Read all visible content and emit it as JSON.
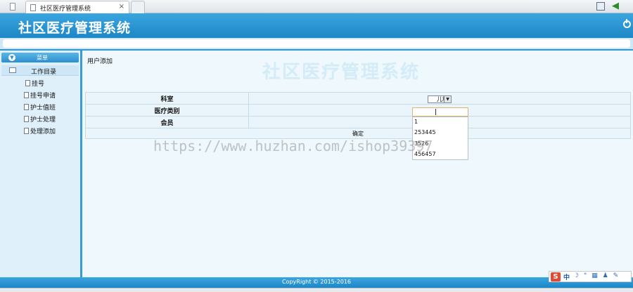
{
  "browser": {
    "tab_title": "社区医疗管理系统",
    "tab_close": "×",
    "back": "◀"
  },
  "app": {
    "title": "社区医疗管理系统"
  },
  "sidebar": {
    "menu_label": "菜单",
    "menu_chevron": "▼",
    "folder_label": "工作目录",
    "items": [
      {
        "label": "挂号"
      },
      {
        "label": "挂号申请"
      },
      {
        "label": "护士值班"
      },
      {
        "label": "护士处理"
      },
      {
        "label": "处理添加"
      }
    ]
  },
  "main": {
    "watermark_title": "社区医疗管理系统",
    "breadcrumb": "用户添加",
    "form": {
      "department_label": "科室",
      "department_value": "儿科",
      "department_arrow": "▼",
      "category_label": "医疗类别",
      "member_label": "会员",
      "confirm_label": "确定"
    },
    "dropdown_options": [
      "1",
      "253445",
      "3526",
      "456457"
    ]
  },
  "watermark": "https://www.huzhan.com/ishop39397",
  "footer": {
    "copyright": "CopyRight © 2015-2016"
  },
  "ime": {
    "logo": "S",
    "mode": "中",
    "tools": "☽ ° ▦ ♟ ✎"
  }
}
